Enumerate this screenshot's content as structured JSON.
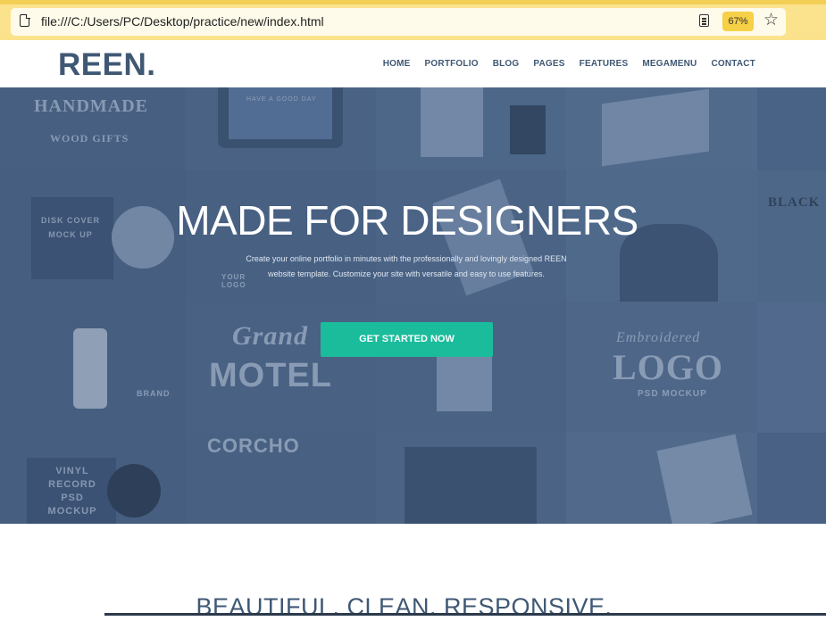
{
  "browser": {
    "url": "file:///C:/Users/PC/Desktop/practice/new/index.html",
    "zoom": "67%"
  },
  "site": {
    "logo": "REEN.",
    "nav": [
      "HOME",
      "PORTFOLIO",
      "BLOG",
      "PAGES",
      "FEATURES",
      "MEGAMENU",
      "CONTACT"
    ]
  },
  "hero": {
    "title": "MADE FOR DESIGNERS",
    "subtitle_line1": "Create your online portfolio in minutes with the professionally and lovingly designed REEN",
    "subtitle_line2": "website template. Customize your site with versatile and easy to use features.",
    "cta_label": "GET STARTED NOW",
    "tiles": {
      "handmade": "HANDMADE",
      "wood_gifts": "WOOD GIFTS",
      "have_a_good_day": "HAVE A GOOD DAY",
      "disk_cover": "DISK COVER MOCK UP",
      "grand": "Grand",
      "motel": "MOTEL",
      "embroidered": "Embroidered",
      "logo": "LOGO",
      "psd_mockup": "PSD MOCKUP",
      "black": "BLACK",
      "corcho": "CORCHO",
      "vinyl": "VINYL RECORD PSD MOCKUP",
      "brand": "BRAND",
      "your_logo": "YOUR LOGO"
    }
  },
  "section": {
    "title": "BEAUTIFUL. CLEAN. RESPONSIVE."
  },
  "colors": {
    "brand": "#3f5874",
    "accent": "#1abc9c",
    "hero_tint": "#4a6384"
  }
}
